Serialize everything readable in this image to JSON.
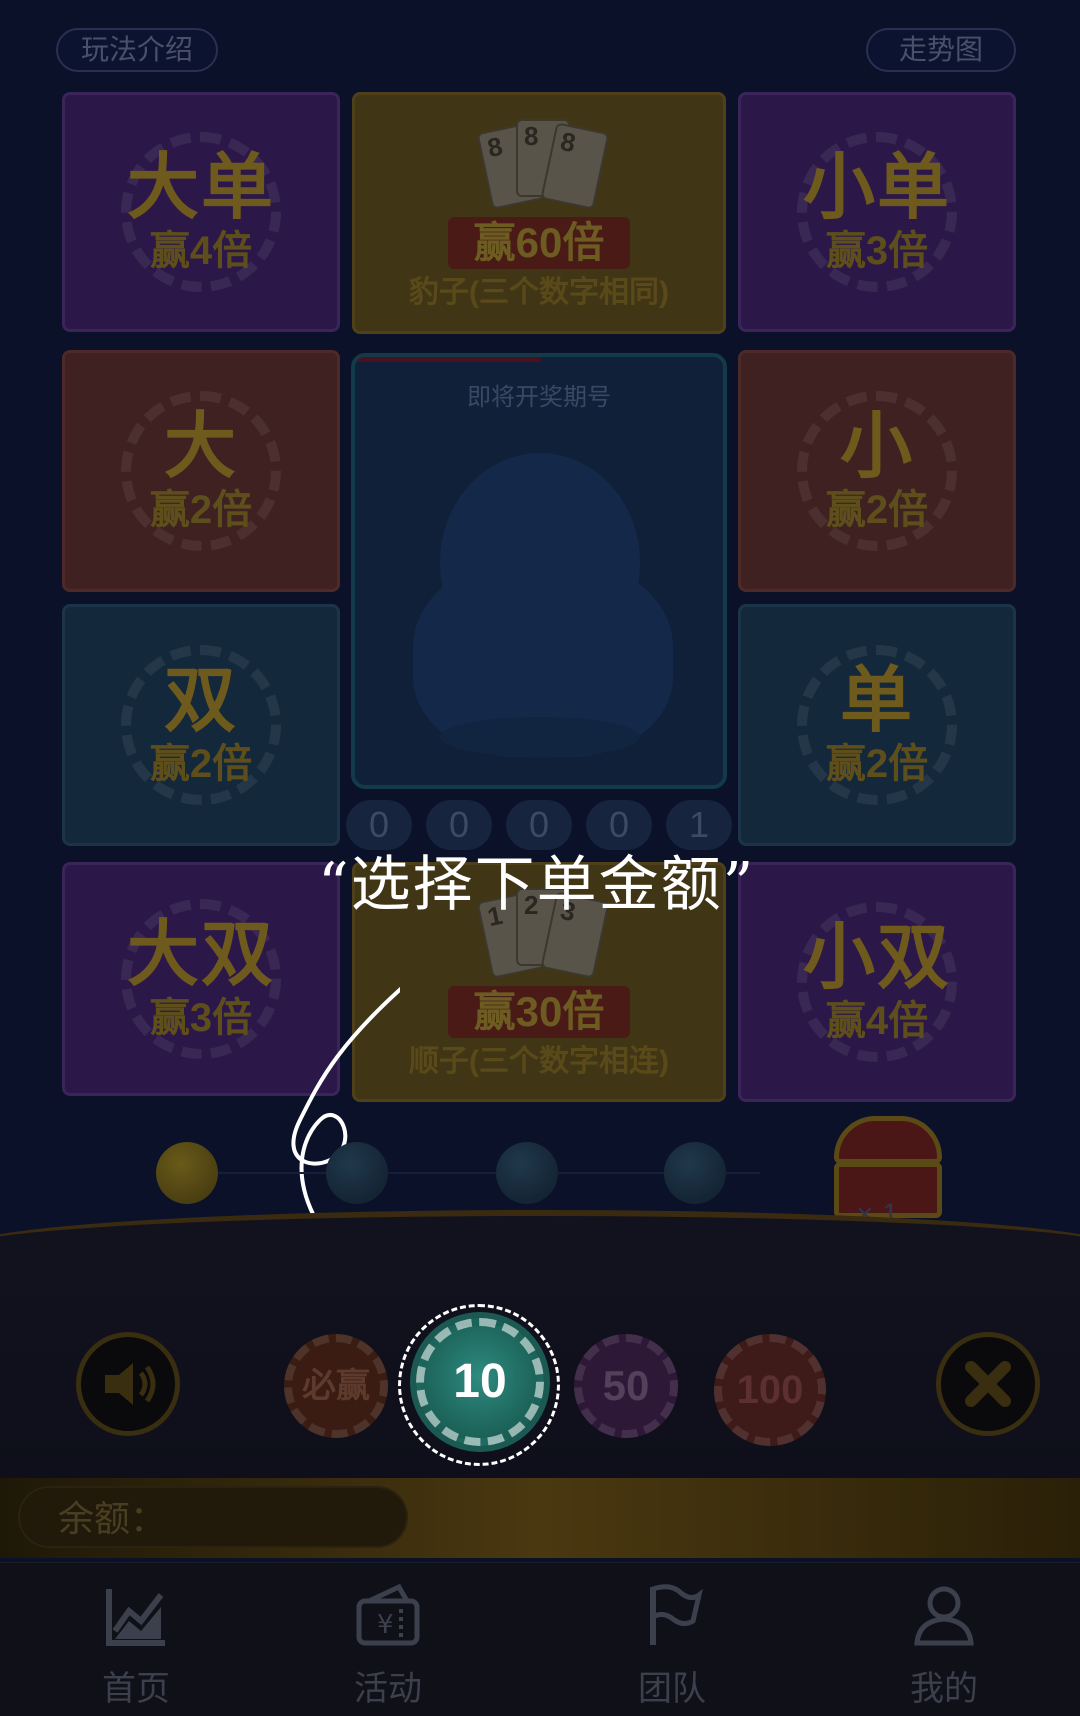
{
  "header": {
    "rules_label": "玩法介绍",
    "trend_label": "走势图"
  },
  "tiles": [
    {
      "big": "大单",
      "sub": "赢4倍"
    },
    {
      "ribbon": "赢60倍",
      "desc": "豹子(三个数字相同)",
      "card_values": [
        "8",
        "8",
        "8"
      ]
    },
    {
      "big": "小单",
      "sub": "赢3倍"
    },
    {
      "big": "大",
      "sub": "赢2倍"
    },
    {
      "big": "小",
      "sub": "赢2倍"
    },
    {
      "big": "双",
      "sub": "赢2倍"
    },
    {
      "big": "单",
      "sub": "赢2倍"
    },
    {
      "big": "大双",
      "sub": "赢3倍"
    },
    {
      "ribbon": "赢30倍",
      "desc": "顺子(三个数字相连)",
      "card_values": [
        "1",
        "2",
        "3"
      ]
    },
    {
      "big": "小双",
      "sub": "赢4倍"
    }
  ],
  "center_panel": {
    "label": "即将开奖期号"
  },
  "issue_digits": [
    "0",
    "0",
    "0",
    "0",
    "1"
  ],
  "callout": {
    "text": "“选择下单金额”"
  },
  "progress": {
    "steps_total": 4,
    "steps_done": 1
  },
  "chest": {
    "count_text": "× 1"
  },
  "chips": {
    "bisheng": "必赢",
    "c10": "10",
    "c50": "50",
    "c100": "100",
    "selected": "10"
  },
  "balance": {
    "label": "余额："
  },
  "tabbar": {
    "home": "首页",
    "activity": "活动",
    "team": "团队",
    "mine": "我的"
  },
  "icons": {
    "sound": "speaker-icon",
    "close": "close-icon",
    "home": "chart-trend-icon",
    "activity": "ticket-yen-icon",
    "team": "flag-icon",
    "mine": "person-icon"
  },
  "colors": {
    "background": "#0a1128",
    "accent_teal": "#2e8a80",
    "gold": "#6e5a1c"
  }
}
